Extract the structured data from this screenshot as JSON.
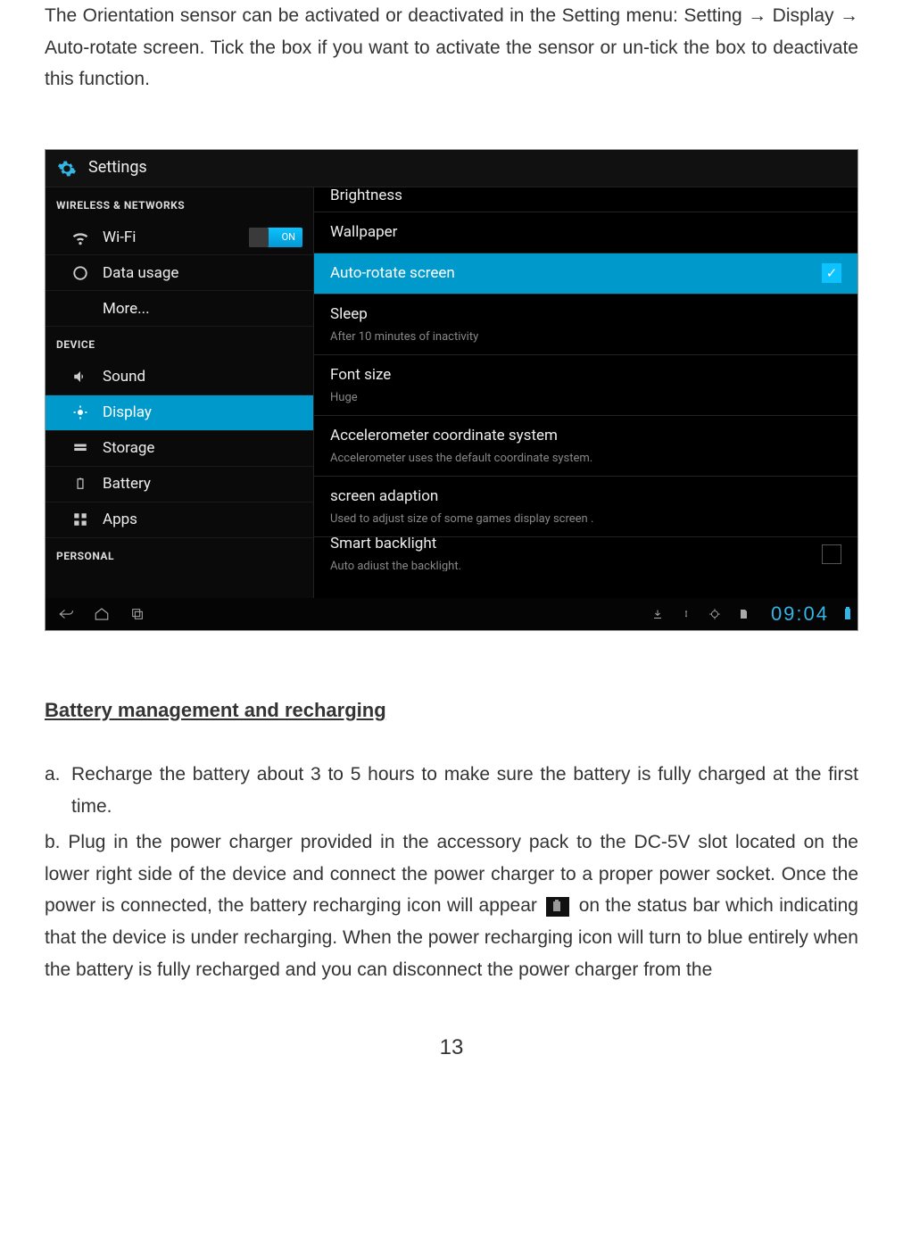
{
  "intro": "The Orientation sensor can be activated or deactivated in the Setting menu: Setting → Display → Auto-rotate screen.   Tick the box if you want to activate the sensor or un-tick the box to deactivate this function.",
  "screenshot": {
    "header_title": "Settings",
    "sidebar": {
      "section_wireless": "WIRELESS & NETWORKS",
      "wifi": "Wi-Fi",
      "wifi_toggle": "ON",
      "data_usage": "Data usage",
      "more": "More...",
      "section_device": "DEVICE",
      "sound": "Sound",
      "display": "Display",
      "storage": "Storage",
      "battery": "Battery",
      "apps": "Apps",
      "section_personal": "PERSONAL"
    },
    "content": {
      "brightness_cut": "Brightness",
      "wallpaper": "Wallpaper",
      "auto_rotate": "Auto-rotate screen",
      "sleep_title": "Sleep",
      "sleep_sub": "After 10 minutes of inactivity",
      "font_title": "Font size",
      "font_sub": "Huge",
      "accel_title": "Accelerometer coordinate system",
      "accel_sub": "Accelerometer uses the default coordinate system.",
      "adapt_title": "screen adaption",
      "adapt_sub": "Used to adjust size of some games display screen .",
      "smart_title": "Smart backlight",
      "smart_sub": "Auto adiust the backlight."
    },
    "clock": "09:04"
  },
  "section_heading": "Battery management and recharging",
  "list": {
    "a_marker": "a.",
    "a_text": "Recharge the battery about 3 to 5 hours to make sure the battery is fully charged at the first time.",
    "b_marker": "b.",
    "b_text_before": "Plug in the power charger provided in the accessory pack to the DC-5V slot located on the lower right side of the device and connect the power charger to a proper power socket.   Once the power is connected, the battery recharging icon will appear",
    "b_text_after": "on the status bar which indicating that the device is under recharging.   When the power recharging icon will turn to blue entirely when the battery is fully recharged and you can disconnect the power charger from the"
  },
  "page_number": "13"
}
